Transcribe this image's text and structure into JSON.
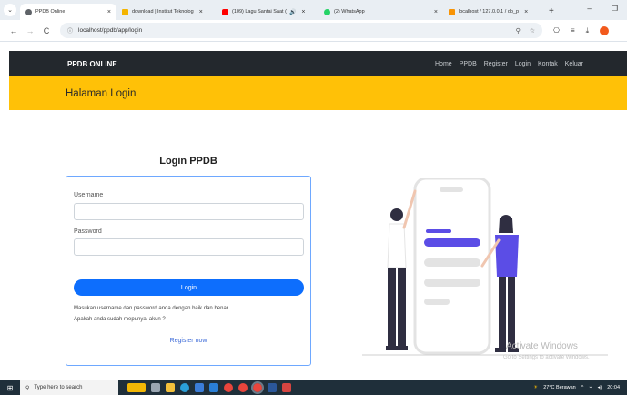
{
  "browser": {
    "tabs": [
      {
        "title": "PPDB Online",
        "active": true,
        "color": "#5f6368"
      },
      {
        "title": "download | Institut Teknolog",
        "active": false,
        "color": "#f4b400"
      },
      {
        "title": "(109) Lagu Santai Saat (",
        "active": false,
        "color": "#ff0000"
      },
      {
        "title": "(2) WhatsApp",
        "active": false,
        "color": "#25d366"
      },
      {
        "title": "localhost / 127.0.0.1 / db_p",
        "active": false,
        "color": "#f89406"
      }
    ],
    "url": "localhost/ppdb/app/login"
  },
  "navbar": {
    "brand": "PPDB ONLINE",
    "links": [
      "Home",
      "PPDB",
      "Register",
      "Login",
      "Kontak",
      "Keluar"
    ]
  },
  "hero": {
    "title": "Halaman Login"
  },
  "login": {
    "title": "Login PPDB",
    "username_label": "Username",
    "password_label": "Password",
    "button": "Login",
    "note1": "Masukan username dan password anda dengan baik dan benar",
    "note2": "Apakah anda sudah mepunyai akun ?",
    "register_link": "Register now"
  },
  "watermark": {
    "line1": "Activate Windows",
    "line2": "Go to Settings to activate Windows."
  },
  "taskbar": {
    "search_placeholder": "Type here to search",
    "weather": "27°C  Berawan",
    "time": "20:04"
  },
  "colors": {
    "accent": "#0d6efd",
    "header": "#ffc107",
    "navbar": "#23282d",
    "illustration": "#5b4de6"
  }
}
